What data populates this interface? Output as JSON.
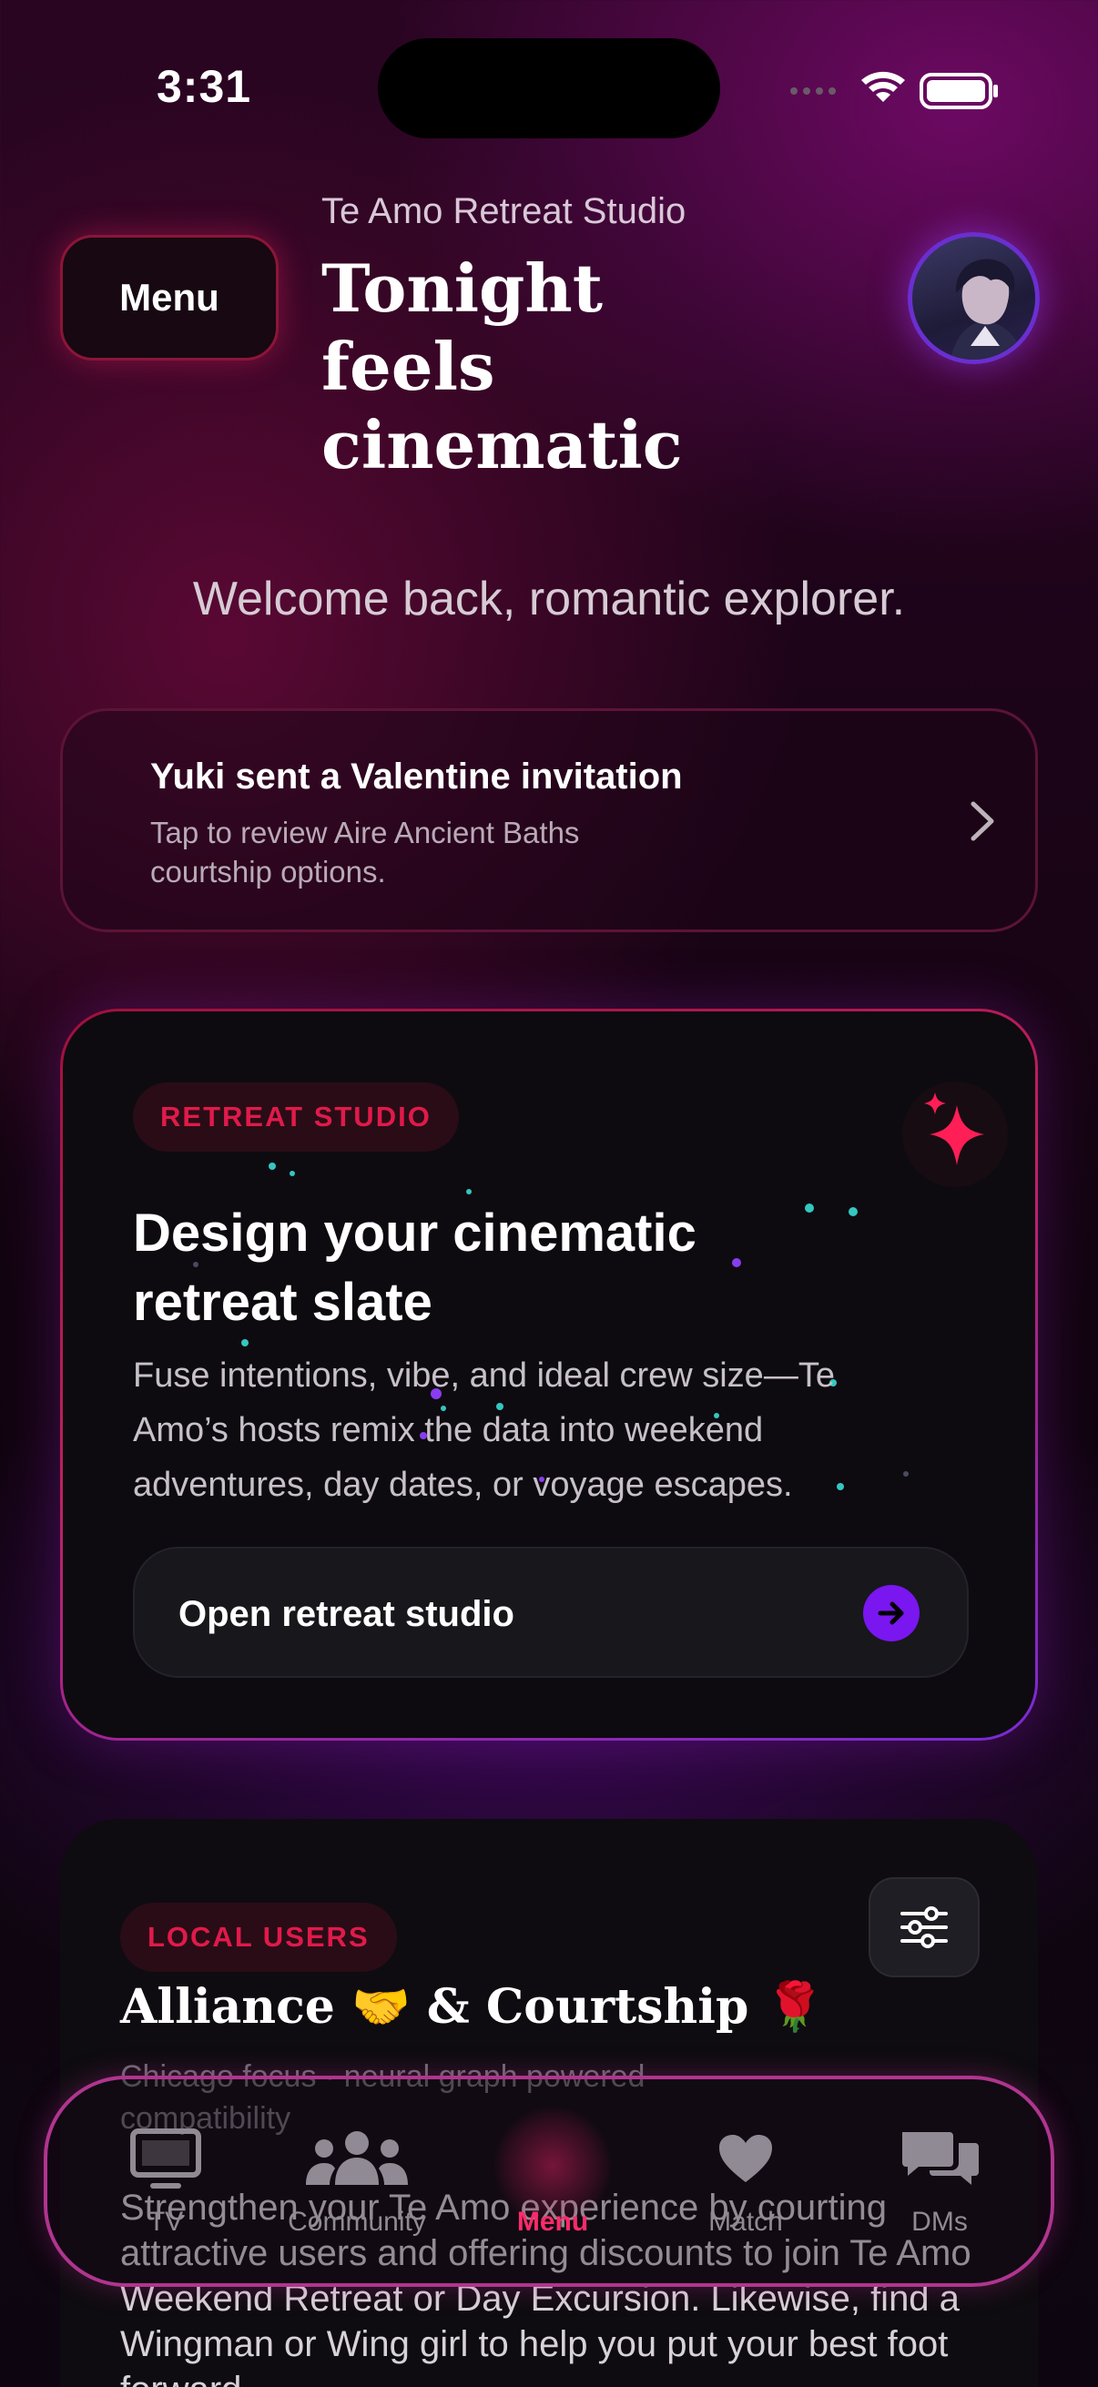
{
  "status_bar": {
    "time": "3:31"
  },
  "header": {
    "menu_label": "Menu",
    "studio_name": "Te Amo Retreat Studio",
    "headline": "Tonight feels cinematic"
  },
  "welcome": "Welcome back, romantic explorer.",
  "invitation": {
    "title": "Yuki sent a Valentine invitation",
    "subtitle": "Tap to review Aire Ancient Baths courtship options."
  },
  "retreat_card": {
    "badge": "RETREAT STUDIO",
    "title": "Design your cinematic retreat slate",
    "body": "Fuse intentions, vibe, and ideal crew size—Te Amo’s hosts remix the data into weekend adventures, day dates, or voyage escapes.",
    "button_label": "Open retreat studio",
    "accent_color": "#7a16f0"
  },
  "local_users_card": {
    "badge": "LOCAL USERS",
    "title": "Alliance 🤝 & Courtship 🌹",
    "focus": "Chicago focus · neural graph powered compatibility",
    "body": "Strengthen your Te Amo experience by courting attractive users and offering discounts to join Te Amo Weekend Retreat or Day Excursion. Likewise, find a Wingman or Wing girl to help you put your best foot forward."
  },
  "tab_bar": {
    "tabs": [
      {
        "label": "TV",
        "icon": "tv-icon"
      },
      {
        "label": "Community",
        "icon": "community-icon"
      },
      {
        "label": "Menu",
        "icon": "menu-lines-icon",
        "active": true
      },
      {
        "label": "Match",
        "icon": "heart-icon"
      },
      {
        "label": "DMs",
        "icon": "chat-bubbles-icon"
      }
    ],
    "active_color": "#ff2a6a"
  }
}
